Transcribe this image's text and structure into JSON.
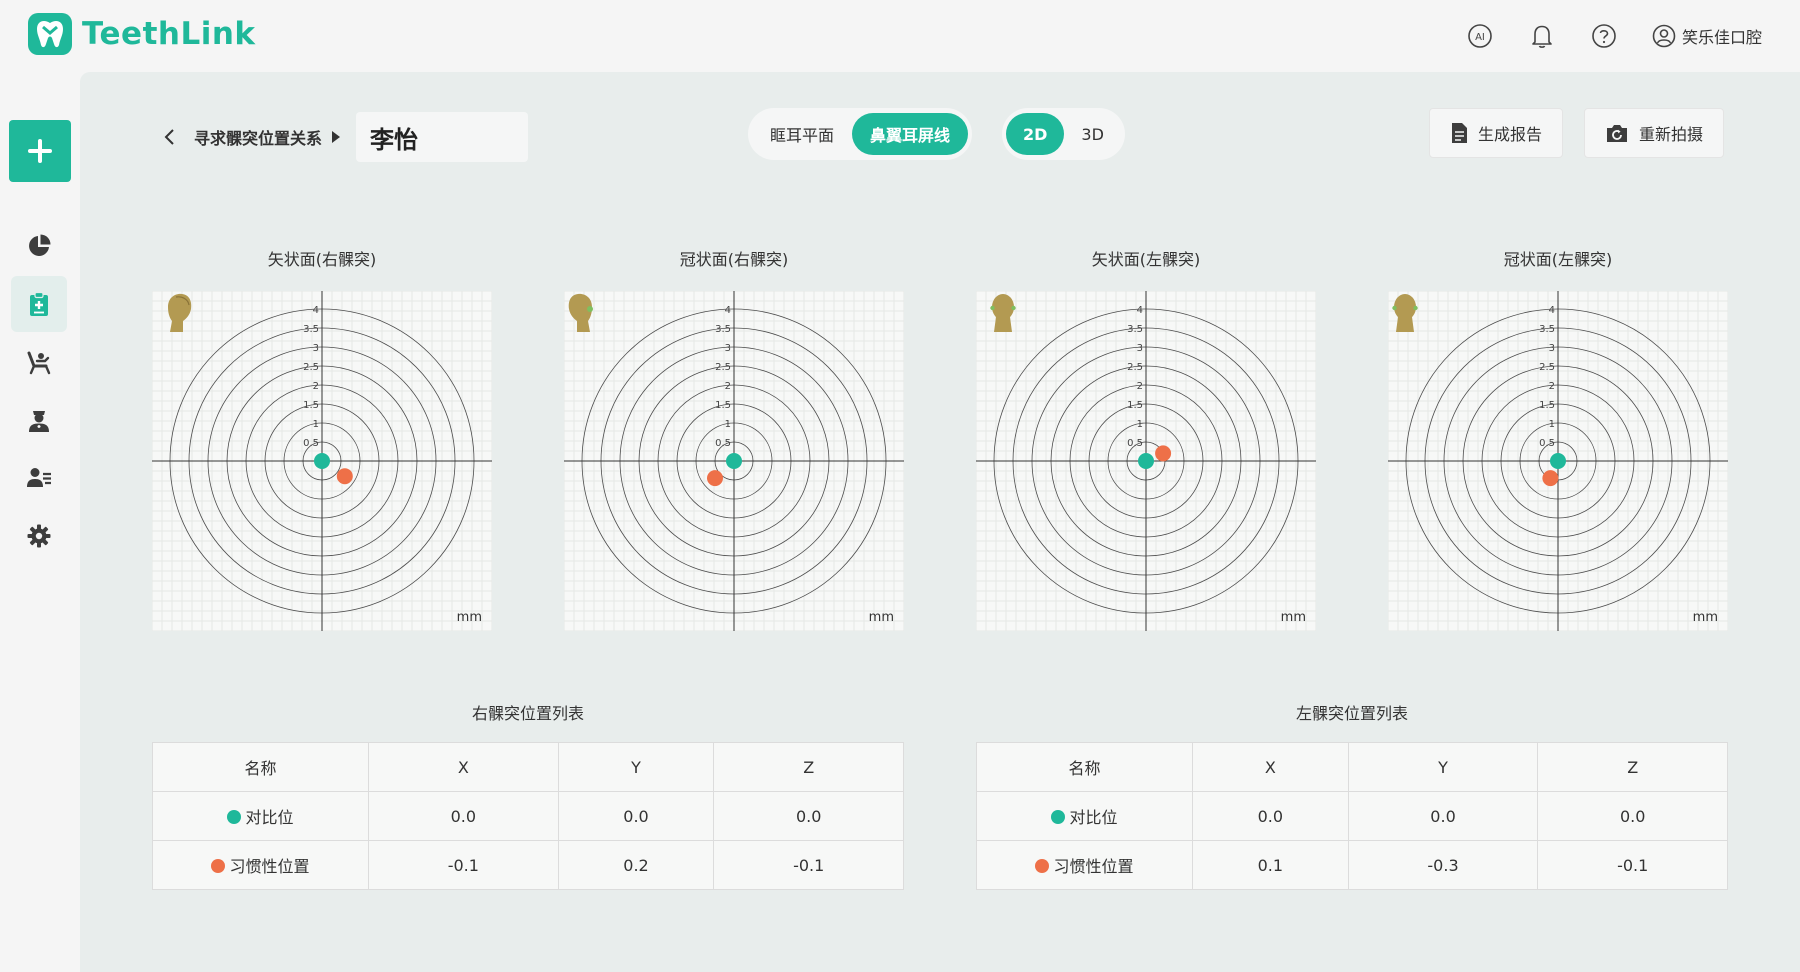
{
  "app": {
    "brand": "TeethLink",
    "accent": "#1fb89a",
    "user_name": "笑乐佳口腔"
  },
  "topbar": {
    "icons": [
      "ai-icon",
      "bell-icon",
      "help-icon",
      "user-icon"
    ]
  },
  "sidebar": {
    "add_icon": "plus-icon",
    "items": [
      {
        "name": "pie-chart-icon",
        "active": false
      },
      {
        "name": "clipboard-icon",
        "active": true
      },
      {
        "name": "dental-chair-icon",
        "active": false
      },
      {
        "name": "doctor-icon",
        "active": false
      },
      {
        "name": "patient-list-icon",
        "active": false
      },
      {
        "name": "gear-icon",
        "active": false
      }
    ]
  },
  "header": {
    "breadcrumb": "寻求髁突位置关系",
    "patient_name": "李怡",
    "plane_tabs": [
      "眶耳平面",
      "鼻翼耳屏线"
    ],
    "plane_selected": "鼻翼耳屏线",
    "view_tabs": [
      "2D",
      "3D"
    ],
    "view_selected": "2D",
    "report_label": "生成报告",
    "retake_label": "重新拍摄"
  },
  "colors": {
    "reference": "#1fb89a",
    "habitual": "#ee7048"
  },
  "charts": [
    {
      "title": "矢状面(右髁突)",
      "unit": "mm",
      "ticks": [
        "0.5",
        "1",
        "1.5",
        "2",
        "2.5",
        "3",
        "3.5",
        "4"
      ],
      "reference": [
        0,
        0
      ],
      "habitual": [
        0.6,
        -0.4
      ]
    },
    {
      "title": "冠状面(右髁突)",
      "unit": "mm",
      "ticks": [
        "0.5",
        "1",
        "1.5",
        "2",
        "2.5",
        "3",
        "3.5",
        "4"
      ],
      "reference": [
        0,
        0
      ],
      "habitual": [
        -0.5,
        -0.45
      ]
    },
    {
      "title": "矢状面(左髁突)",
      "unit": "mm",
      "ticks": [
        "0.5",
        "1",
        "1.5",
        "2",
        "2.5",
        "3",
        "3.5",
        "4"
      ],
      "reference": [
        0,
        0
      ],
      "habitual": [
        0.45,
        0.2
      ]
    },
    {
      "title": "冠状面(左髁突)",
      "unit": "mm",
      "ticks": [
        "0.5",
        "1",
        "1.5",
        "2",
        "2.5",
        "3",
        "3.5",
        "4"
      ],
      "reference": [
        0,
        0
      ],
      "habitual": [
        -0.2,
        -0.45
      ]
    }
  ],
  "tables": [
    {
      "title": "右髁突位置列表",
      "headers": [
        "名称",
        "X",
        "Y",
        "Z"
      ],
      "rows": [
        {
          "name": "对比位",
          "x": "0.0",
          "y": "0.0",
          "z": "0.0"
        },
        {
          "name": "习惯性位置",
          "x": "-0.1",
          "y": "0.2",
          "z": "-0.1"
        }
      ]
    },
    {
      "title": "左髁突位置列表",
      "headers": [
        "名称",
        "X",
        "Y",
        "Z"
      ],
      "rows": [
        {
          "name": "对比位",
          "x": "0.0",
          "y": "0.0",
          "z": "0.0"
        },
        {
          "name": "习惯性位置",
          "x": "0.1",
          "y": "-0.3",
          "z": "-0.1"
        }
      ]
    }
  ]
}
